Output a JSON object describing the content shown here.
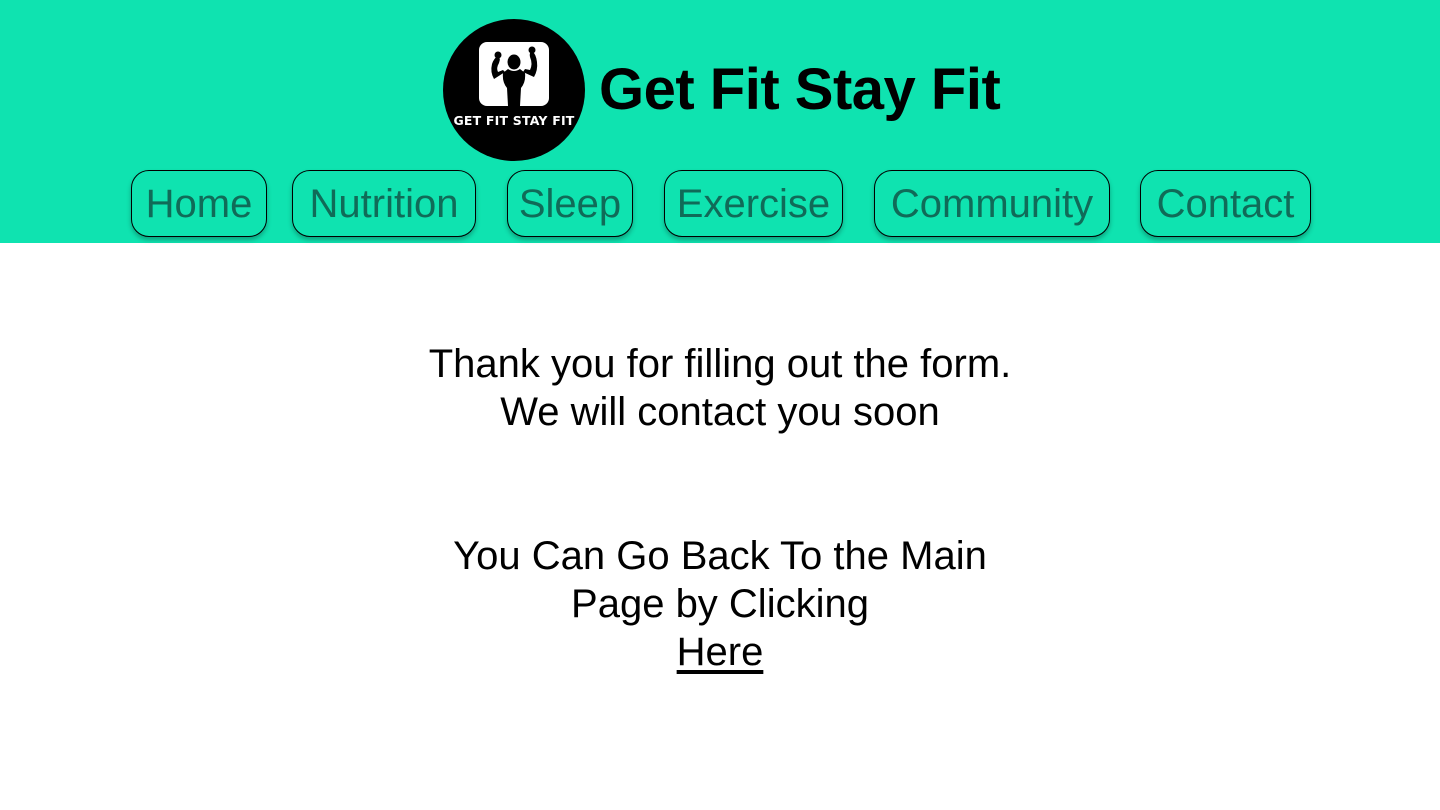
{
  "colors": {
    "header_bg": "#0fe3b0",
    "nav_text": "#106b58",
    "text": "#000000",
    "background": "#ffffff"
  },
  "header": {
    "logo": {
      "icon": "flexing-bodybuilder-icon",
      "text": "GET FIT STAY FIT"
    },
    "title": "Get Fit Stay Fit"
  },
  "nav": {
    "items": [
      {
        "label": "Home"
      },
      {
        "label": "Nutrition"
      },
      {
        "label": "Sleep"
      },
      {
        "label": "Exercise"
      },
      {
        "label": "Community"
      },
      {
        "label": "Contact"
      }
    ]
  },
  "main": {
    "thanks_line1": "Thank you for filling out the form.",
    "thanks_line2": "We will contact you soon",
    "back_line1": "You Can Go Back To the Main",
    "back_line2": "Page by Clicking",
    "here_link": "Here"
  }
}
